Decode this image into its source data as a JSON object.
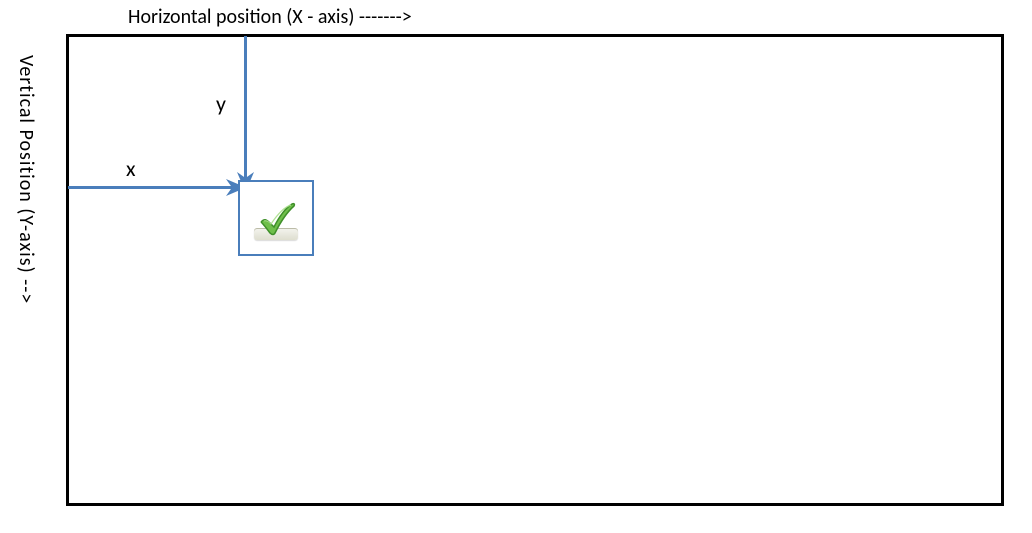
{
  "labels": {
    "x_axis": "Horizontal position (X - axis) ------->",
    "y_axis": "Vertical Position (Y-axis)   -->",
    "x": "x",
    "y": "y"
  },
  "icons": {
    "check": "checkmark-icon"
  },
  "colors": {
    "arrow": "#4a7ebb",
    "border": "#000000",
    "check_fill": "#6fbf4a",
    "check_stroke": "#3f8f2a"
  }
}
